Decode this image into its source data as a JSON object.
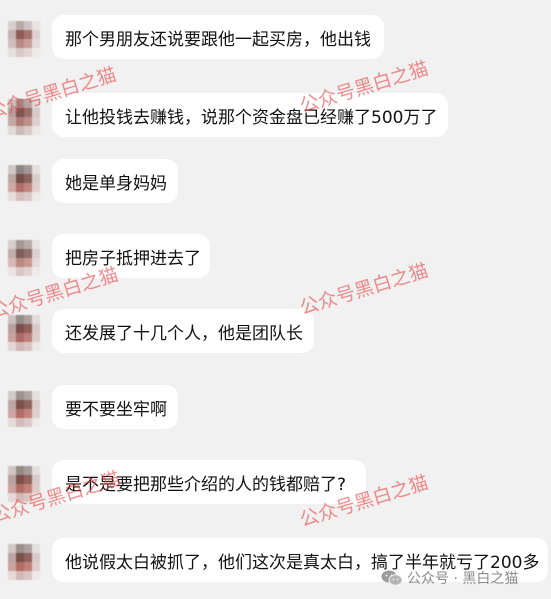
{
  "messages": [
    {
      "text": "那个男朋友还说要跟他一起买房，他出钱"
    },
    {
      "text": "让他投钱去赚钱，说那个资金盘已经赚了500万了"
    },
    {
      "text": "她是单身妈妈"
    },
    {
      "text": "把房子抵押进去了"
    },
    {
      "text": "还发展了十几个人，他是团队长"
    },
    {
      "text": "要不要坐牢啊"
    },
    {
      "text": "是不是要把那些介绍的人的钱都赔了?"
    },
    {
      "text": "他说假太白被抓了，他们这次是真太白，搞了半年就亏了200多"
    }
  ],
  "watermarks": [
    "公众号黑白之猫",
    "公众号黑白之猫",
    "公众号黑白之猫",
    "公众号黑白之猫",
    "公众号黑白之猫",
    "公众号黑白之猫"
  ],
  "footer": {
    "icon": "wechat-icon",
    "label": "公众号 · 黑白之猫"
  }
}
